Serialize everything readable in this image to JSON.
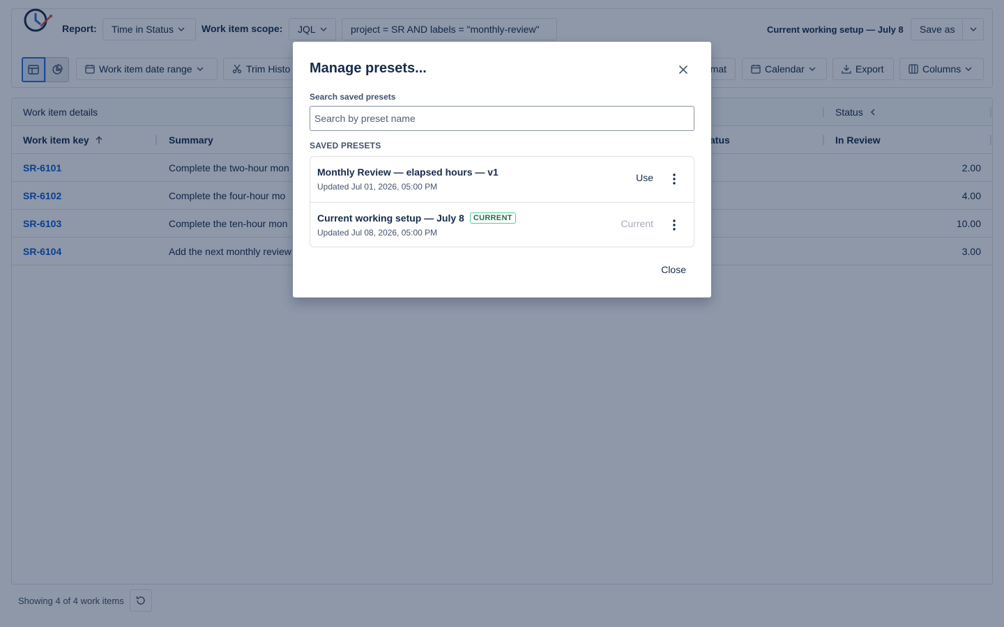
{
  "toolbar": {
    "report_label": "Report:",
    "report_value": "Time in Status",
    "scope_label": "Work item scope:",
    "scope_type": "JQL",
    "jql_query": "project = SR AND labels = \"monthly-review\"",
    "current_setup_label": "Current working setup — July 8",
    "save_as_label": "Save as",
    "date_range_label": "Work item date range",
    "trim_history_label": "Trim Histo",
    "format_label": "mat",
    "calendar_label": "Calendar",
    "export_label": "Export",
    "columns_label": "Columns"
  },
  "table": {
    "group_header_left": "Work item details",
    "group_header_right": "Status",
    "columns": {
      "key": "Work item key",
      "summary": "Summary",
      "status_partial": "atus",
      "in_review": "In Review"
    },
    "rows": [
      {
        "key": "SR-6101",
        "summary": "Complete the two-hour mon",
        "in_review": "2.00"
      },
      {
        "key": "SR-6102",
        "summary": "Complete the four-hour mo",
        "in_review": "4.00"
      },
      {
        "key": "SR-6103",
        "summary": "Complete the ten-hour mon",
        "in_review": "10.00"
      },
      {
        "key": "SR-6104",
        "summary": "Add the next monthly review",
        "in_review": "3.00"
      }
    ]
  },
  "footer": {
    "showing_text": "Showing 4 of 4 work items"
  },
  "modal": {
    "title": "Manage presets...",
    "search_label": "Search saved presets",
    "search_placeholder": "Search by preset name",
    "search_value": "",
    "section_label": "SAVED PRESETS",
    "presets": [
      {
        "name": "Monthly Review — elapsed hours — v1",
        "updated": "Updated Jul 01, 2026, 05:00 PM",
        "action": "Use",
        "is_current": false
      },
      {
        "name": "Current working setup — July 8",
        "updated": "Updated Jul 08, 2026, 05:00 PM",
        "action": "Current",
        "badge": "CURRENT",
        "is_current": true
      }
    ],
    "close_label": "Close"
  },
  "colors": {
    "link": "#0c5bd3",
    "overlay": "rgba(9,30,66,0.46)",
    "current_badge_border": "#4bce97",
    "current_badge_text": "#216e4e"
  }
}
